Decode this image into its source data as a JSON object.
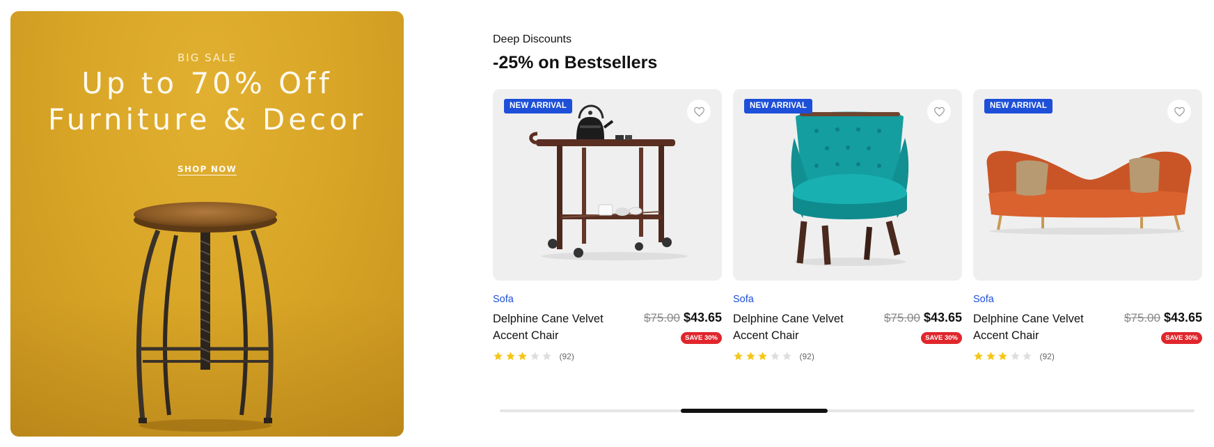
{
  "promo": {
    "kicker": "BIG SALE",
    "title_line1": "Up to 70% Off",
    "title_line2": "Furniture & Decor",
    "cta": "SHOP NOW",
    "background_color": "#d9a627"
  },
  "section": {
    "eyebrow": "Deep Discounts",
    "title": "-25% on Bestsellers"
  },
  "products": [
    {
      "badge": "NEW ARRIVAL",
      "category": "Sofa",
      "name": "Delphine Cane Velvet Accent Chair",
      "old_price": "$75.00",
      "price": "$43.65",
      "save_label": "SAVE 30%",
      "rating": 3,
      "rating_max": 5,
      "reviews": "(92)",
      "image": "bar-cart"
    },
    {
      "badge": "NEW ARRIVAL",
      "category": "Sofa",
      "name": "Delphine Cane Velvet Accent Chair",
      "old_price": "$75.00",
      "price": "$43.65",
      "save_label": "SAVE 30%",
      "rating": 3,
      "rating_max": 5,
      "reviews": "(92)",
      "image": "teal-velvet-chair"
    },
    {
      "badge": "NEW ARRIVAL",
      "category": "Sofa",
      "name": "Delphine Cane Velvet Accent Chair",
      "old_price": "$75.00",
      "price": "$43.65",
      "save_label": "SAVE 30%",
      "rating": 3,
      "rating_max": 5,
      "reviews": "(92)",
      "image": "orange-sofa"
    }
  ],
  "colors": {
    "accent": "#1d4fd8",
    "sale": "#e0262c",
    "star_filled": "#f5c518",
    "star_empty": "#dedede"
  },
  "scrollbar": {
    "position": 0.33
  }
}
